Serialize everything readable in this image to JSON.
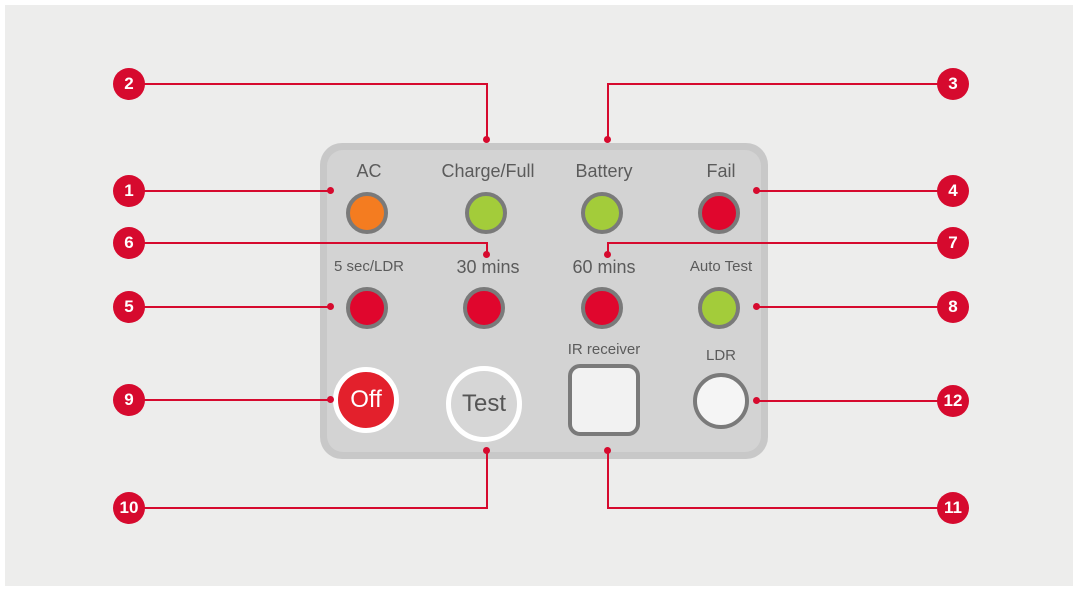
{
  "colors": {
    "accent": "#d60a2e",
    "background": "#ededec",
    "panel": "#d3d3d3",
    "led_orange": "#f47c20",
    "led_green": "#a3cc3a",
    "led_red": "#e0062d",
    "off_button": "#e3202c"
  },
  "panel": {
    "row1": {
      "ac": "AC",
      "charge_full": "Charge/Full",
      "battery": "Battery",
      "fail": "Fail"
    },
    "row2": {
      "sec_ldr": "5 sec/LDR",
      "mins30": "30 mins",
      "mins60": "60 mins",
      "auto_test": "Auto Test"
    },
    "row3": {
      "ir_receiver": "IR receiver",
      "ldr": "LDR",
      "off_button": "Off",
      "test_button": "Test"
    }
  },
  "callouts": [
    "1",
    "2",
    "3",
    "4",
    "5",
    "6",
    "7",
    "8",
    "9",
    "10",
    "11",
    "12"
  ]
}
